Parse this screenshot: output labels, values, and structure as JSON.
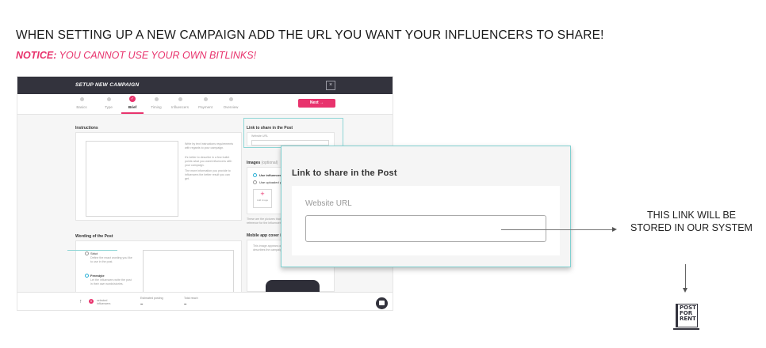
{
  "headline": "WHEN SETTING UP A NEW CAMPAIGN ADD THE URL YOU WANT YOUR INFLUENCERS TO SHARE!",
  "notice": {
    "prefix": "NOTICE:",
    "text": " YOU CANNOT USE YOUR OWN BITLINKS!"
  },
  "app": {
    "title": "SETUP NEW CAMPAIGN",
    "close": "×",
    "steps": [
      {
        "label": "Basics",
        "state": "done-gray"
      },
      {
        "label": "Type",
        "state": "gray"
      },
      {
        "label": "Brief",
        "state": "active"
      },
      {
        "label": "Timing",
        "state": "gray"
      },
      {
        "label": "Influencers",
        "state": "gray"
      },
      {
        "label": "Payment",
        "state": "gray"
      },
      {
        "label": "Overview",
        "state": "gray"
      }
    ],
    "next_button": "Next →",
    "instructions_title": "Instructions",
    "instructions_help": [
      "Write by text instructions requirements with regards to your campaign.",
      "It's better to describe in a few bullet points what you want influencers with your campaign.",
      "The more information you provide to influencers the better result you can get."
    ],
    "link_title": "Link to share in the Post",
    "link_field_label": "Website URL",
    "images_title": "Images",
    "images_optional": "(optional)",
    "images_options": [
      "Use influencers' images",
      "Use uploaded pictures"
    ],
    "add_image": "Add image",
    "images_help": "These are the pictures that you want to share or to use as a reference for the influencer.",
    "mobile_cover_title": "Mobile app cover image",
    "mobile_cover_help": "This image appears on mobile app of influencers and describes the campaign.",
    "wording_title": "Wording of the Post",
    "wording_options": [
      {
        "label": "Strict",
        "desc": "Define the exact wording you like to use in the post."
      },
      {
        "label": "Freestyle",
        "desc": "Let the influencers write the post in their own words/stories."
      }
    ],
    "footer": {
      "selected_count": "0",
      "selected_label": "selected influencers",
      "est_label": "Estimated posting",
      "est_value": "–",
      "reach_label": "Total reach",
      "reach_value": "–"
    }
  },
  "zoom": {
    "title": "Link to share in the Post",
    "field_label": "Website URL",
    "field_value": ""
  },
  "side_note": "THIS LINK WILL BE STORED IN OUR SYSTEM",
  "logo_text": [
    "POST",
    "FOR",
    "RENT"
  ],
  "colors": {
    "accent": "#e8336d",
    "dark": "#33333d",
    "teal": "#7fcfcf"
  }
}
